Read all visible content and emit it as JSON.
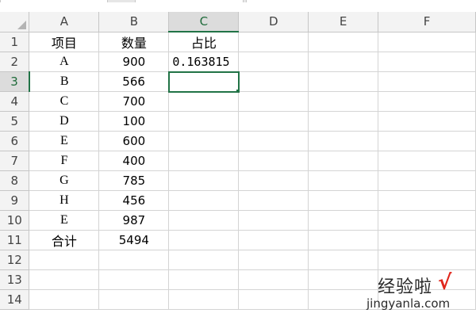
{
  "columns": [
    "A",
    "B",
    "C",
    "D",
    "E",
    "F"
  ],
  "rows": [
    {
      "num": "1",
      "a": "项目",
      "b": "数量",
      "c": "占比"
    },
    {
      "num": "2",
      "a": "A",
      "b": "900",
      "c": "0.163815"
    },
    {
      "num": "3",
      "a": "B",
      "b": "566",
      "c": ""
    },
    {
      "num": "4",
      "a": "C",
      "b": "700",
      "c": ""
    },
    {
      "num": "5",
      "a": "D",
      "b": "100",
      "c": ""
    },
    {
      "num": "6",
      "a": "E",
      "b": "600",
      "c": ""
    },
    {
      "num": "7",
      "a": "F",
      "b": "400",
      "c": ""
    },
    {
      "num": "8",
      "a": "G",
      "b": "785",
      "c": ""
    },
    {
      "num": "9",
      "a": "H",
      "b": "456",
      "c": ""
    },
    {
      "num": "10",
      "a": "E",
      "b": "987",
      "c": ""
    },
    {
      "num": "11",
      "a": "合计",
      "b": "5494",
      "c": ""
    },
    {
      "num": "12",
      "a": "",
      "b": "",
      "c": ""
    },
    {
      "num": "13",
      "a": "",
      "b": "",
      "c": ""
    },
    {
      "num": "14",
      "a": "",
      "b": "",
      "c": ""
    }
  ],
  "active_cell": "C3",
  "watermark": {
    "title": "经验啦",
    "check": "√",
    "url": "jingyanla.com"
  },
  "colors": {
    "selection": "#217346",
    "header_bg": "#f3f3f3",
    "gridline": "#d4d4d4",
    "watermark_check": "#e0261c"
  }
}
